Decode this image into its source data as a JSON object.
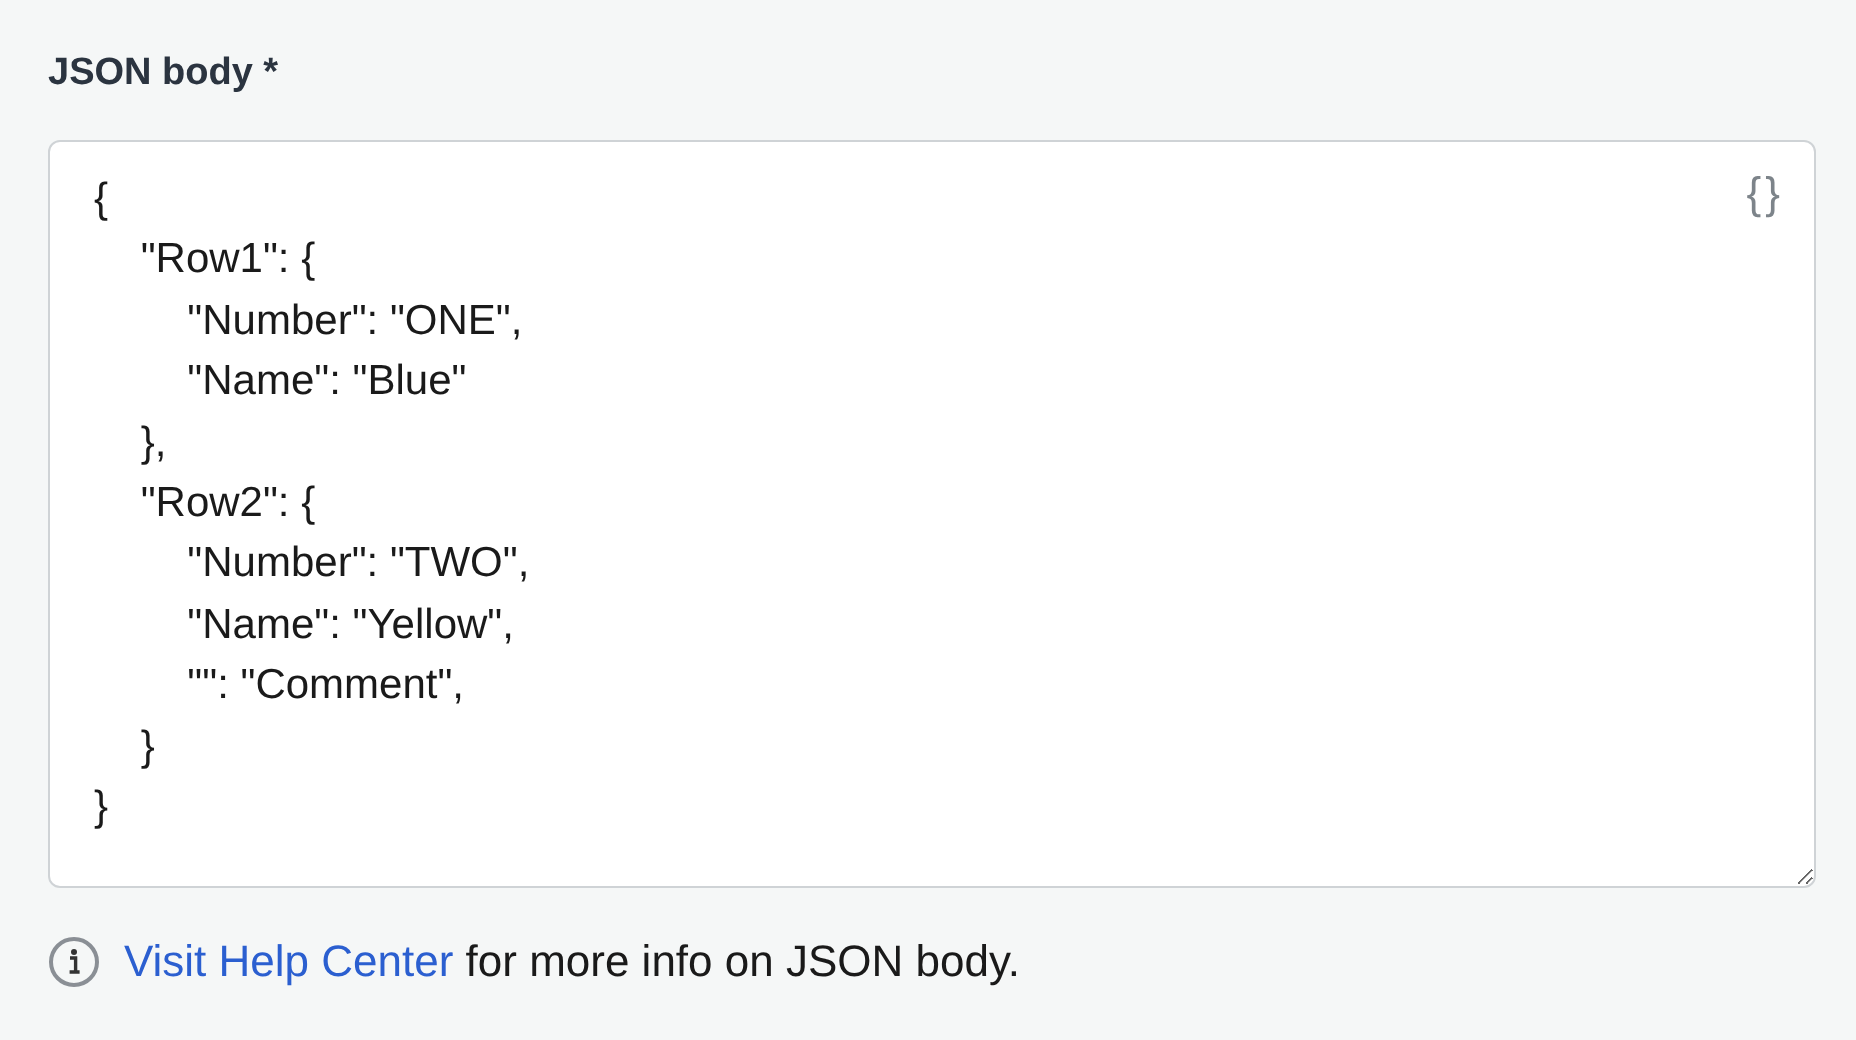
{
  "field": {
    "label": "JSON body *",
    "value": "{\n    \"Row1\": {\n        \"Number\": \"ONE\",\n        \"Name\": \"Blue\"\n    },\n    \"Row2\": {\n        \"Number\": \"TWO\",\n        \"Name\": \"Yellow\",\n        \"\": \"Comment\",\n    }\n}",
    "format_icon": "{}"
  },
  "help": {
    "link": "Visit Help Center",
    "text": " for more info on JSON body."
  }
}
